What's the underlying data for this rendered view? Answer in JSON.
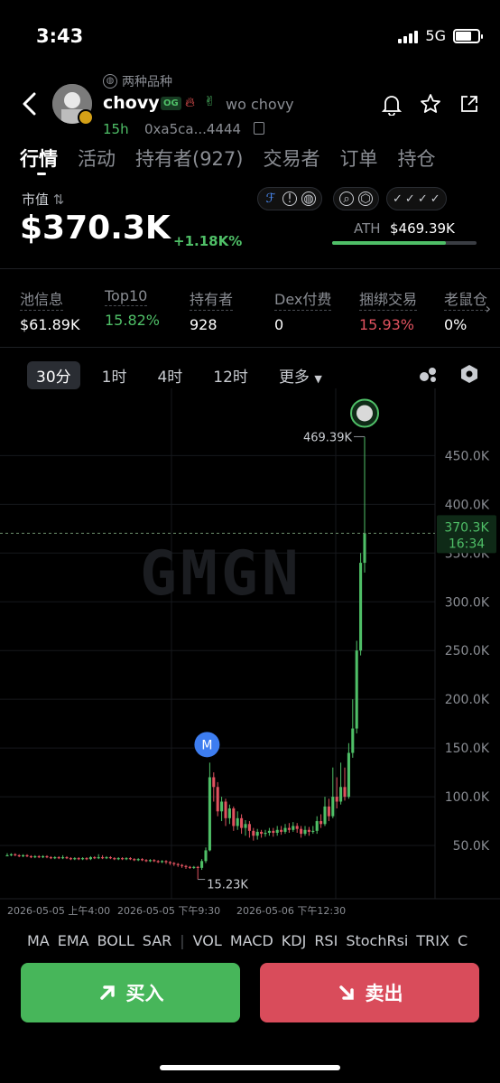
{
  "status_bar": {
    "time": "3:43",
    "network": "5G"
  },
  "header": {
    "variety": "两种品种",
    "token_name": "chovy",
    "og_badge": "OG",
    "twitter_name": "wo chovy",
    "age": "15h",
    "address": "0xa5ca...4444"
  },
  "tabs": [
    "行情",
    "活动",
    "持有者(927)",
    "交易者",
    "订单",
    "持仓"
  ],
  "market": {
    "label": "市值",
    "value": "$370.3K",
    "change": "+1.18K%",
    "ath_label": "ATH",
    "ath_value": "$469.39K",
    "ath_progress": 0.79
  },
  "stats": [
    {
      "label": "池信息",
      "value": "$61.89K",
      "tone": "neutral"
    },
    {
      "label": "Top10",
      "value": "15.82%",
      "tone": "green"
    },
    {
      "label": "持有者",
      "value": "928",
      "tone": "neutral"
    },
    {
      "label": "Dex付费",
      "value": "0",
      "tone": "neutral"
    },
    {
      "label": "捆绑交易",
      "value": "15.93%",
      "tone": "red"
    },
    {
      "label": "老鼠仓",
      "value": "0%",
      "tone": "neutral"
    }
  ],
  "intervals": [
    "30分",
    "1时",
    "4时",
    "12时",
    "更多"
  ],
  "chart_data": {
    "type": "candlestick",
    "watermark": "GMGN",
    "y_ticks": [
      "450.0K",
      "400.0K",
      "350.0K",
      "300.0K",
      "250.0K",
      "200.0K",
      "150.0K",
      "100.0K",
      "50.0K"
    ],
    "y_tick_values": [
      450,
      400,
      350,
      300,
      250,
      200,
      150,
      100,
      50
    ],
    "ylim": [
      0,
      480
    ],
    "x_ticks": [
      "2026-05-05 上午4:00",
      "2026-05-05 下午9:30",
      "2026-05-06 下午12:30"
    ],
    "current_price": "370.3K",
    "current_price_value": 370.3,
    "countdown": "16:34",
    "high_label": "469.39K",
    "high_value": 469.39,
    "low_label": "15.23K",
    "low_value": 15.23,
    "marker": "M",
    "candles": [
      [
        40,
        40,
        42,
        39
      ],
      [
        40,
        41,
        42,
        39
      ],
      [
        41,
        40,
        42,
        39
      ],
      [
        40,
        39,
        41,
        38
      ],
      [
        39,
        40,
        41,
        38
      ],
      [
        40,
        39,
        41,
        38
      ],
      [
        39,
        38,
        40,
        37
      ],
      [
        38,
        39,
        40,
        37
      ],
      [
        39,
        38,
        40,
        37
      ],
      [
        38,
        39,
        40,
        37
      ],
      [
        39,
        38,
        40,
        37
      ],
      [
        38,
        37,
        39,
        36
      ],
      [
        37,
        38,
        39,
        36
      ],
      [
        38,
        37,
        39,
        36
      ],
      [
        37,
        38,
        40,
        36
      ],
      [
        38,
        37,
        39,
        36
      ],
      [
        37,
        36,
        38,
        35
      ],
      [
        36,
        37,
        38,
        35
      ],
      [
        37,
        36,
        38,
        35
      ],
      [
        36,
        37,
        38,
        35
      ],
      [
        37,
        36,
        38,
        35
      ],
      [
        36,
        38,
        39,
        35
      ],
      [
        38,
        37,
        39,
        36
      ],
      [
        37,
        38,
        41,
        36
      ],
      [
        38,
        37,
        40,
        36
      ],
      [
        37,
        38,
        39,
        36
      ],
      [
        38,
        37,
        39,
        36
      ],
      [
        37,
        36,
        38,
        35
      ],
      [
        36,
        37,
        38,
        35
      ],
      [
        37,
        36,
        38,
        35
      ],
      [
        36,
        37,
        38,
        35
      ],
      [
        37,
        36,
        38,
        35
      ],
      [
        36,
        35,
        37,
        34
      ],
      [
        35,
        36,
        37,
        34
      ],
      [
        36,
        35,
        37,
        34
      ],
      [
        35,
        34,
        36,
        33
      ],
      [
        34,
        35,
        36,
        33
      ],
      [
        35,
        34,
        36,
        33
      ],
      [
        34,
        33,
        35,
        32
      ],
      [
        33,
        34,
        35,
        32
      ],
      [
        34,
        33,
        35,
        31
      ],
      [
        33,
        32,
        34,
        30
      ],
      [
        32,
        31,
        33,
        29
      ],
      [
        31,
        30,
        32,
        28
      ],
      [
        30,
        29,
        31,
        27
      ],
      [
        29,
        28,
        30,
        26
      ],
      [
        28,
        27,
        29,
        26
      ],
      [
        27,
        28,
        29,
        26
      ],
      [
        28,
        27,
        29,
        15.23
      ],
      [
        27,
        34,
        36,
        25
      ],
      [
        34,
        45,
        48,
        32
      ],
      [
        45,
        120,
        135,
        44
      ],
      [
        120,
        110,
        125,
        95
      ],
      [
        110,
        85,
        115,
        80
      ],
      [
        85,
        95,
        100,
        75
      ],
      [
        95,
        78,
        98,
        70
      ],
      [
        78,
        88,
        92,
        72
      ],
      [
        88,
        70,
        90,
        65
      ],
      [
        70,
        78,
        85,
        66
      ],
      [
        78,
        68,
        82,
        62
      ],
      [
        68,
        72,
        76,
        60
      ],
      [
        72,
        65,
        75,
        58
      ],
      [
        65,
        60,
        68,
        55
      ],
      [
        60,
        64,
        67,
        56
      ],
      [
        64,
        62,
        66,
        58
      ],
      [
        62,
        63,
        66,
        59
      ],
      [
        63,
        65,
        68,
        60
      ],
      [
        65,
        63,
        68,
        59
      ],
      [
        63,
        66,
        70,
        60
      ],
      [
        66,
        64,
        70,
        61
      ],
      [
        64,
        68,
        72,
        62
      ],
      [
        68,
        66,
        73,
        63
      ],
      [
        66,
        70,
        74,
        64
      ],
      [
        70,
        67,
        73,
        63
      ],
      [
        67,
        62,
        70,
        58
      ],
      [
        62,
        66,
        70,
        60
      ],
      [
        66,
        64,
        69,
        60
      ],
      [
        64,
        65,
        70,
        62
      ],
      [
        65,
        75,
        80,
        62
      ],
      [
        75,
        72,
        82,
        68
      ],
      [
        72,
        90,
        100,
        70
      ],
      [
        90,
        80,
        98,
        75
      ],
      [
        80,
        100,
        130,
        78
      ],
      [
        100,
        95,
        120,
        88
      ],
      [
        95,
        110,
        135,
        92
      ],
      [
        110,
        100,
        130,
        96
      ],
      [
        100,
        145,
        155,
        98
      ],
      [
        145,
        170,
        200,
        140
      ],
      [
        170,
        250,
        260,
        165
      ],
      [
        250,
        340,
        350,
        245
      ],
      [
        340,
        370.3,
        469.39,
        330
      ]
    ]
  },
  "indicators": [
    "MA",
    "EMA",
    "BOLL",
    "SAR",
    "VOL",
    "MACD",
    "KDJ",
    "RSI",
    "StochRsi",
    "TRIX",
    "C"
  ],
  "actions": {
    "buy": "买入",
    "sell": "卖出"
  },
  "colors": {
    "up": "#4fbf67",
    "down": "#e0525f",
    "buy": "#47b65a",
    "sell": "#d94c5b"
  }
}
